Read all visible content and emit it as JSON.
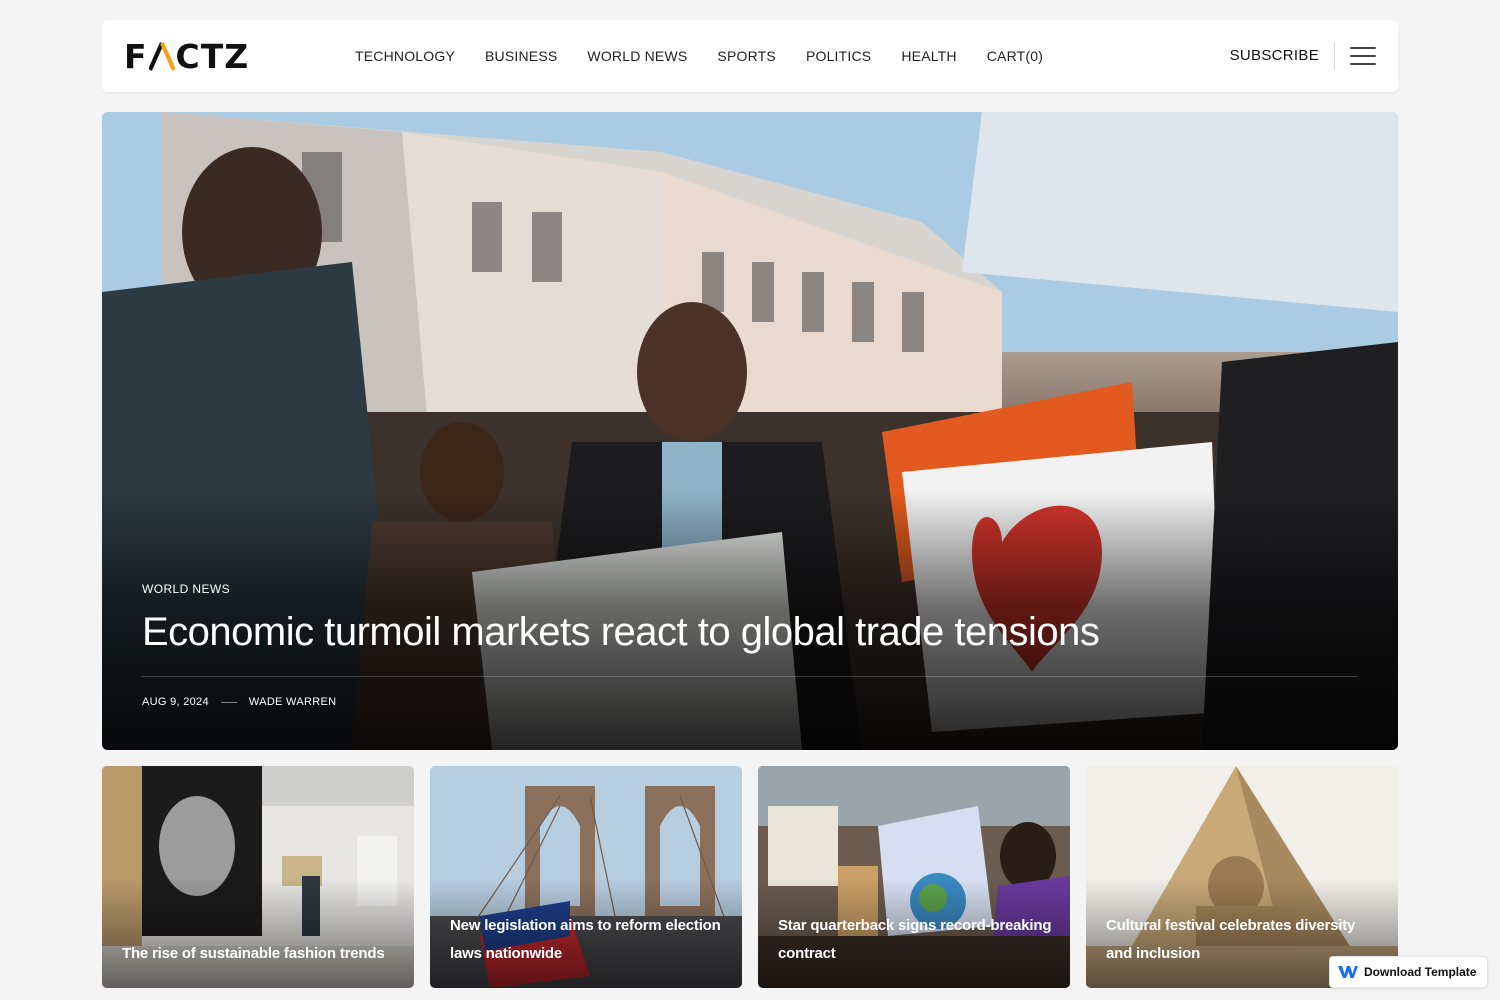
{
  "header": {
    "logo": {
      "left": "F",
      "right": "CTZ"
    },
    "nav": [
      "TECHNOLOGY",
      "BUSINESS",
      "WORLD NEWS",
      "SPORTS",
      "POLITICS",
      "HEALTH",
      "CART(0)"
    ],
    "subscribe_label": "SUBSCRIBE",
    "menu_icon": "hamburger-menu-icon"
  },
  "hero": {
    "category": "WORLD NEWS",
    "title": "Economic turmoil markets react to global trade tensions",
    "date": "AUG 9, 2024",
    "author": "WADE WARREN"
  },
  "cards": [
    {
      "title": "The rise of sustainable fashion trends"
    },
    {
      "title": "New legislation aims to reform election laws nationwide"
    },
    {
      "title": "Star quarterback signs record-breaking contract"
    },
    {
      "title": "Cultural festival celebrates diversity and inclusion"
    }
  ],
  "badge": {
    "label": "Download Template",
    "icon": "webflow-logo-icon"
  },
  "colors": {
    "logo_accent": "#f2a31b",
    "text": "#111111",
    "background": "#f4f4f4",
    "badge_brand": "#146ef5"
  }
}
